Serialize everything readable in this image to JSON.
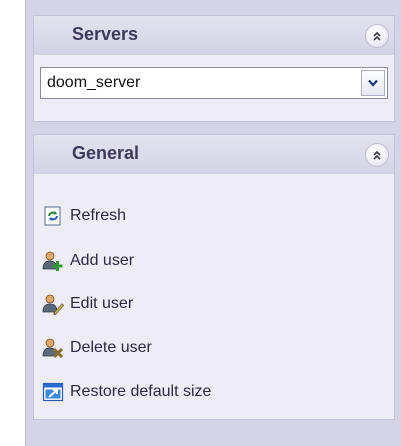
{
  "panels": {
    "servers": {
      "title": "Servers",
      "selected_server": "doom_server"
    },
    "general": {
      "title": "General",
      "items": [
        {
          "label": "Refresh",
          "icon": "refresh-icon"
        },
        {
          "label": "Add user",
          "icon": "add-user-icon"
        },
        {
          "label": "Edit user",
          "icon": "edit-user-icon"
        },
        {
          "label": "Delete user",
          "icon": "delete-user-icon"
        },
        {
          "label": "Restore default size",
          "icon": "restore-size-icon"
        }
      ]
    }
  },
  "colors": {
    "pane_background": "#d5d4e6",
    "header_background": "#e3e3ee",
    "body_background": "#eeedf5",
    "title_text": "#3c3c5a",
    "link_text": "#2a2a46"
  }
}
